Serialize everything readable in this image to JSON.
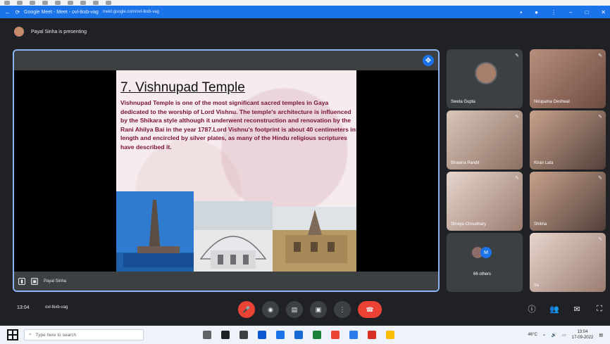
{
  "browser": {
    "tab_title": "Google Meet - Meet - ovl-tkxb-vag",
    "url": "meet.google.com/ovl-tkxb-vag"
  },
  "meet": {
    "presenting_text": "Payal Sinha is presenting",
    "presenter_name": "Payal Sinha",
    "time": "13:04",
    "meeting_code": "ovl-tkxb-vag"
  },
  "slide": {
    "title": "7. Vishnupad Temple",
    "body": "Vishnupad Temple is one of the most significant sacred temples in Gaya dedicated to the worship of Lord Vishnu. The temple's architecture is influenced by the Shikara style although it underwent reconstruction and renovation by the Rani Ahilya Bai in the year 1787.Lord Vishnu's footprint is about 40 centimeters in length and encircled by silver plates, as many of the Hindu religious scriptures have described it."
  },
  "participants": [
    {
      "name": "Sweta Gupta"
    },
    {
      "name": "Nirupama Deshwal"
    },
    {
      "name": "Bhawna Pandit"
    },
    {
      "name": "Kiran Lata"
    },
    {
      "name": "Shreya Choudhary"
    },
    {
      "name": "Shikha"
    },
    {
      "name": "Ira"
    }
  ],
  "others": {
    "label": "66 others",
    "badge": "M"
  },
  "taskbar": {
    "search_placeholder": "Type here to search",
    "weather": "46°C",
    "clock_time": "13:04",
    "clock_date": "17-09-2022"
  }
}
